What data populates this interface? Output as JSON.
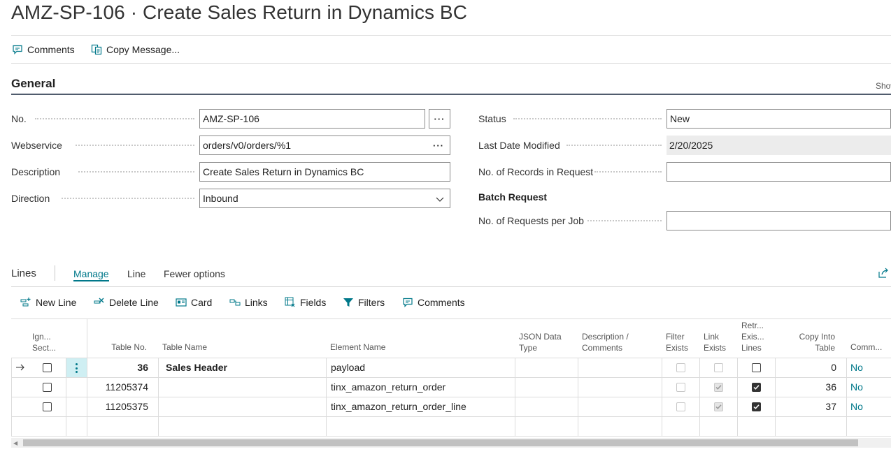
{
  "page": {
    "title": "AMZ-SP-106 · Create Sales Return in Dynamics BC"
  },
  "actions": {
    "comments": "Comments",
    "copy_message": "Copy Message..."
  },
  "general": {
    "title": "General",
    "show_more": "Show",
    "no": {
      "label": "No.",
      "value": "AMZ-SP-106"
    },
    "webservice": {
      "label": "Webservice",
      "value": "orders/v0/orders/%1"
    },
    "description": {
      "label": "Description",
      "value": "Create Sales Return in Dynamics BC"
    },
    "direction": {
      "label": "Direction",
      "value": "Inbound"
    },
    "status": {
      "label": "Status",
      "value": "New"
    },
    "last_modified": {
      "label": "Last Date Modified",
      "value": "2/20/2025"
    },
    "records_in_request": {
      "label": "No. of Records in Request",
      "value": ""
    },
    "batch_request": "Batch Request",
    "requests_per_job": {
      "label": "No. of Requests per Job",
      "value": ""
    }
  },
  "lines": {
    "title": "Lines",
    "tabs": [
      "Manage",
      "Line",
      "Fewer options"
    ],
    "toolbar": {
      "new_line": "New Line",
      "delete_line": "Delete Line",
      "card": "Card",
      "links": "Links",
      "fields": "Fields",
      "filters": "Filters",
      "comments": "Comments"
    },
    "columns": {
      "ignore": [
        "Ign...",
        "Sect..."
      ],
      "table_no": "Table No.",
      "table_name": "Table Name",
      "element_name": "Element Name",
      "json_type": [
        "JSON Data",
        "Type"
      ],
      "desc": [
        "Description /",
        "Comments"
      ],
      "filter_exists": [
        "Filter",
        "Exists"
      ],
      "link_exists": [
        "Link",
        "Exists"
      ],
      "retr": [
        "Retr...",
        "Exis...",
        "Lines"
      ],
      "copy_into": [
        "Copy Into",
        "Table"
      ],
      "comm": "Comm..."
    },
    "rows": [
      {
        "ignore": false,
        "table_no": "36",
        "table_name": "Sales Header",
        "element": "payload",
        "filter": false,
        "link": false,
        "retr": false,
        "copy": "0",
        "comm": "No"
      },
      {
        "ignore": false,
        "table_no": "11205374",
        "table_name": "",
        "element": "tinx_amazon_return_order",
        "filter": false,
        "link": true,
        "retr": true,
        "copy": "36",
        "comm": "No"
      },
      {
        "ignore": false,
        "table_no": "11205375",
        "table_name": "",
        "element": "tinx_amazon_return_order_line",
        "filter": false,
        "link": true,
        "retr": true,
        "copy": "37",
        "comm": "No"
      }
    ]
  },
  "colors": {
    "accent": "#00788a",
    "selected_row": "#cfeff3"
  }
}
